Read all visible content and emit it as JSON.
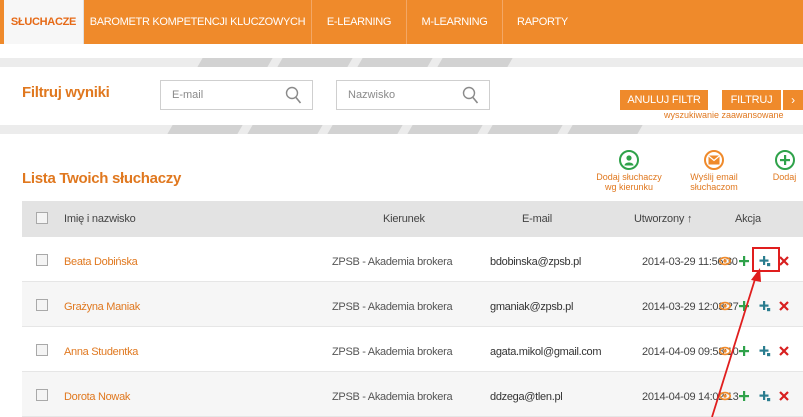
{
  "nav": {
    "items": [
      {
        "label": "SŁUCHACZE",
        "active": true
      },
      {
        "label": "BAROMETR KOMPETENCJI KLUCZOWYCH",
        "active": false
      },
      {
        "label": "E-LEARNING",
        "active": false
      },
      {
        "label": "M-LEARNING",
        "active": false
      },
      {
        "label": "RAPORTY",
        "active": false
      }
    ]
  },
  "filter": {
    "title": "Filtruj wyniki",
    "email_placeholder": "E-mail",
    "name_placeholder": "Nazwisko",
    "cancel_label": "ANULUJ FILTR",
    "filter_label": "FILTRUJ",
    "filter_arrow": "›",
    "advanced_label": "wyszukiwanie zaawansowane"
  },
  "list": {
    "title": "Lista Twoich słuchaczy",
    "actions": [
      {
        "label": "Dodaj słuchaczy wg kierunku",
        "lines": [
          "Dodaj słuchaczy",
          "wg kierunku"
        ],
        "icon": "add-user-icon"
      },
      {
        "label": "Wyślij email słuchaczom",
        "lines": [
          "Wyślij email",
          "słuchaczom"
        ],
        "icon": "mail-icon"
      },
      {
        "label": "Dodaj",
        "lines": [
          "Dodaj",
          ""
        ],
        "icon": "plus-circle-icon"
      }
    ]
  },
  "table": {
    "headers": {
      "name": "Imię i nazwisko",
      "kierunek": "Kierunek",
      "email": "E-mail",
      "created": "Utworzony ↑",
      "action": "Akcja"
    },
    "rows": [
      {
        "name": "Beata Dobińska",
        "kierunek": "ZPSB - Akademia brokera",
        "email": "bdobinska@zpsb.pl",
        "created": "2014-03-29 11:56:30"
      },
      {
        "name": "Grażyna Maniak",
        "kierunek": "ZPSB - Akademia brokera",
        "email": "gmaniak@zpsb.pl",
        "created": "2014-03-29 12:03:27"
      },
      {
        "name": "Anna Studentka",
        "kierunek": "ZPSB - Akademia brokera",
        "email": "agata.mikol@gmail.com",
        "created": "2014-04-09 09:58:10"
      },
      {
        "name": "Dorota Nowak",
        "kierunek": "ZPSB - Akademia brokera",
        "email": "ddzega@tlen.pl",
        "created": "2014-04-09 14:02:13"
      }
    ]
  },
  "colors": {
    "accent": "#ef8a2b",
    "link": "#e0781f",
    "green": "#2fa24a",
    "red": "#d81f1f",
    "highlight": "#e01e1e"
  }
}
